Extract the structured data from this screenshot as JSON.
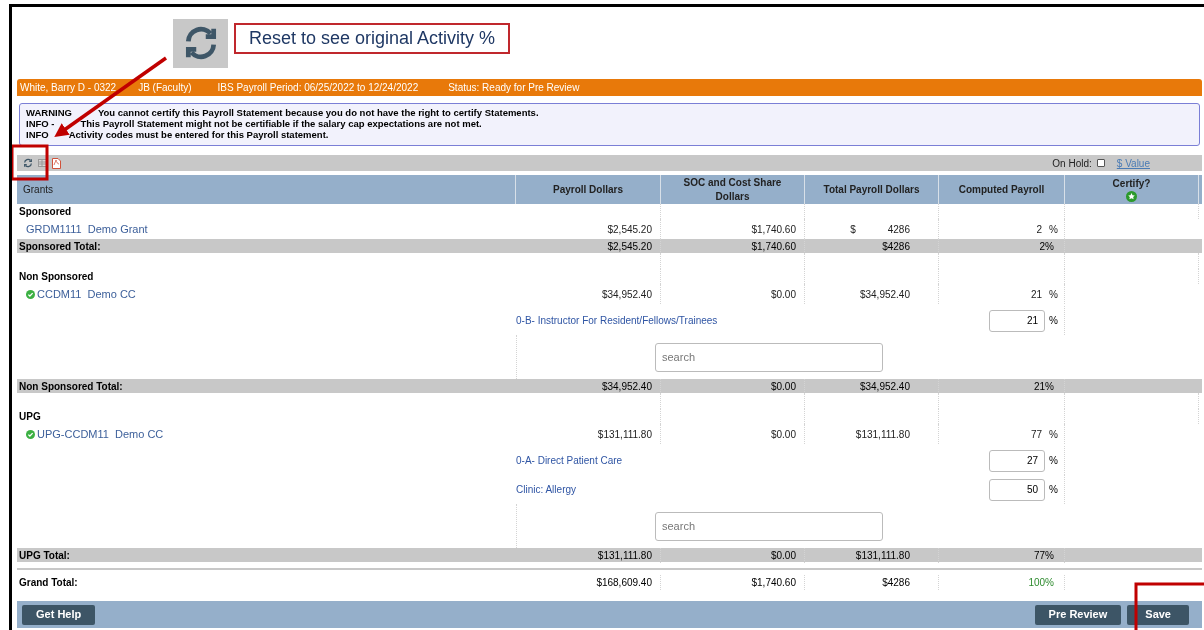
{
  "callout": {
    "text": "Reset to see original Activity %"
  },
  "header": {
    "employee": "White, Barry D - 0322",
    "employee_rest": "JB (Faculty)",
    "period": "IBS Payroll Period: 06/25/2022 to 12/24/2022",
    "status": "Status: Ready for Pre Review"
  },
  "messages": [
    {
      "lead": "WARNING",
      "text": "You cannot certify this Payroll Statement because you do not have the right to certify Statements."
    },
    {
      "lead": "INFO -",
      "text": "This Payroll Statement might not be certifiable if the salary cap expectations are not met."
    },
    {
      "lead": "INFO",
      "text": "Activity codes must be entered for this Payroll statement."
    }
  ],
  "toolbar": {
    "on_hold_label": "On Hold:",
    "on_hold": false,
    "value_link": "$ Value"
  },
  "columns": [
    "Grants",
    "Payroll Dollars",
    "SOC and Cost Share Dollars",
    "Total Payroll Dollars",
    "Computed Payroll",
    "Certify?"
  ],
  "sections": [
    {
      "label": "Sponsored",
      "grants": [
        {
          "name": "GRDM1111  Demo Grant",
          "verified": false,
          "payroll": "$2,545.20",
          "soc": "$1,740.60",
          "total_currency": "$",
          "total": "4286",
          "computed": "2",
          "unit": "%"
        }
      ],
      "total": {
        "label": "Sponsored Total:",
        "payroll": "$2,545.20",
        "soc": "$1,740.60",
        "total": "$4286",
        "computed": "2%"
      }
    },
    {
      "label": "Non Sponsored",
      "grants": [
        {
          "name": "CCDM11  Demo CC",
          "verified": true,
          "payroll": "$34,952.40",
          "soc": "$0.00",
          "total": "$34,952.40",
          "computed": "21",
          "unit": "%"
        }
      ],
      "activities": [
        {
          "label": "0-B- Instructor For Resident/Fellows/Trainees",
          "value": "21",
          "unit": "%"
        }
      ],
      "search": {
        "placeholder": "search"
      },
      "total": {
        "label": "Non Sponsored Total:",
        "payroll": "$34,952.40",
        "soc": "$0.00",
        "total": "$34,952.40",
        "computed": "21%"
      }
    },
    {
      "label": "UPG",
      "grants": [
        {
          "name": "UPG-CCDM11  Demo CC",
          "verified": true,
          "payroll": "$131,111.80",
          "soc": "$0.00",
          "total": "$131,111.80",
          "computed": "77",
          "unit": "%"
        }
      ],
      "activities": [
        {
          "label": "0-A- Direct Patient Care",
          "value": "27",
          "unit": "%"
        },
        {
          "label": "Clinic: Allergy",
          "value": "50",
          "unit": "%"
        }
      ],
      "search": {
        "placeholder": "search"
      },
      "total": {
        "label": "UPG Total:",
        "payroll": "$131,111.80",
        "soc": "$0.00",
        "total": "$131,111.80",
        "computed": "77%"
      }
    }
  ],
  "grand_total": {
    "label": "Grand Total:",
    "payroll": "$168,609.40",
    "soc": "$1,740.60",
    "total": "$4286",
    "computed": "100%",
    "complete": true
  },
  "footer": {
    "left_buttons": [
      "Get Help"
    ],
    "right_buttons": [
      "Pre Review",
      "Save"
    ]
  }
}
